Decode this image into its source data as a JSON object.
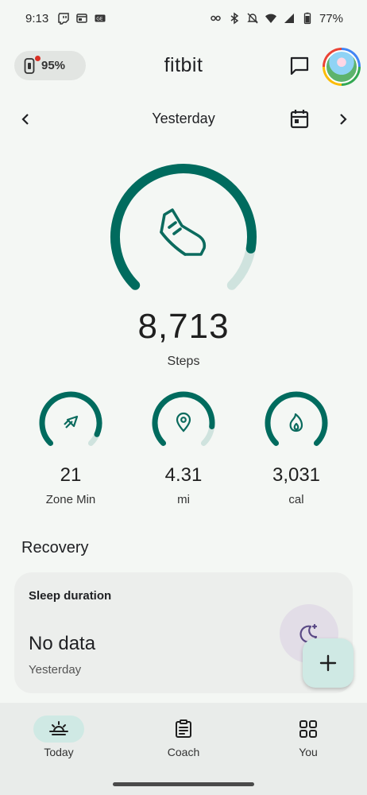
{
  "status_bar": {
    "time": "9:13",
    "battery_percent": "77%",
    "left_icons": [
      "twitch-icon",
      "browser-icon",
      "news-icon"
    ],
    "right_icons": [
      "vpn-key-icon",
      "bluetooth-icon",
      "mute-icon",
      "wifi-icon",
      "signal-icon",
      "battery-icon"
    ]
  },
  "header": {
    "device_battery": "95%",
    "app_name": "fitbit"
  },
  "date_nav": {
    "label": "Yesterday"
  },
  "steps": {
    "value": "8,713",
    "label": "Steps",
    "goal_progress": 0.87
  },
  "stats": [
    {
      "value": "21",
      "label": "Zone Min",
      "icon": "zone-arrow-icon",
      "progress": 0.92
    },
    {
      "value": "4.31",
      "label": "mi",
      "icon": "location-pin-icon",
      "progress": 0.86
    },
    {
      "value": "3,031",
      "label": "cal",
      "icon": "flame-icon",
      "progress": 1.0
    }
  ],
  "recovery": {
    "section_title": "Recovery",
    "card_title": "Sleep duration",
    "value": "No data",
    "date": "Yesterday"
  },
  "bottom_nav": {
    "items": [
      {
        "label": "Today",
        "icon": "sunrise-icon",
        "active": true
      },
      {
        "label": "Coach",
        "icon": "clipboard-icon",
        "active": false
      },
      {
        "label": "You",
        "icon": "grid-icon",
        "active": false
      }
    ]
  },
  "colors": {
    "accent": "#006b5e",
    "track": "#cfe3de",
    "background": "#f4f7f4"
  }
}
